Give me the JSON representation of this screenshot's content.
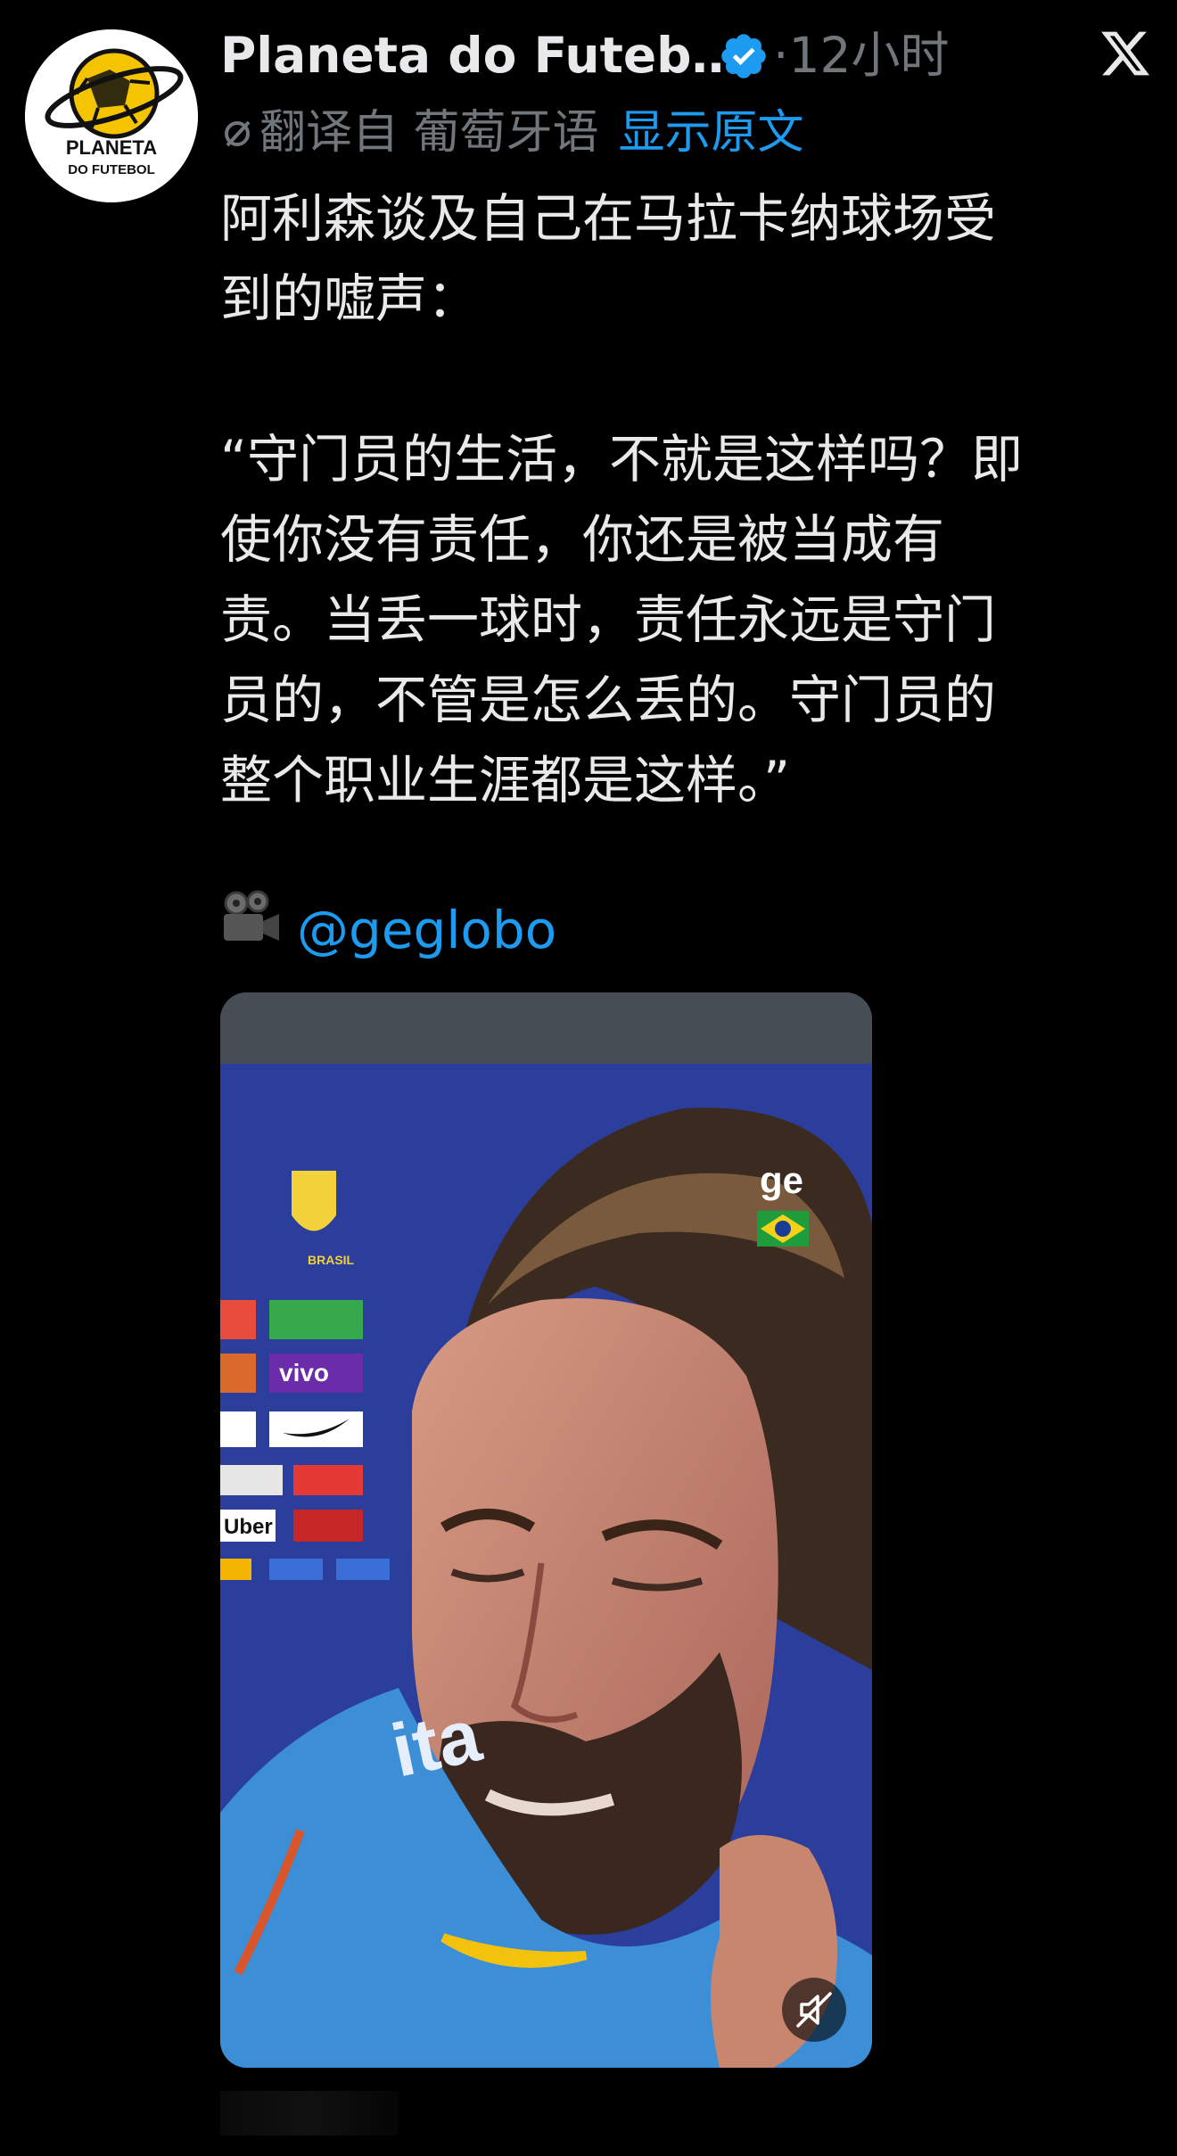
{
  "author": {
    "name": "Planeta do Futeb…",
    "avatar_icon": "planeta-do-futebol-logo",
    "avatar_label_line1": "PLANETA",
    "avatar_label_line2": "DO FUTEBOL",
    "verified_icon": "verified-badge-icon"
  },
  "timestamp": "·12小时",
  "close_icon": "x-logo-icon",
  "translation": {
    "icon": "translate-icon",
    "label": "翻译自 葡萄牙语",
    "show_original": "显示原文"
  },
  "tweet": {
    "line1": "阿利森谈及自己在马拉卡纳球场受",
    "line2": "到的嘘声：",
    "quote1": "“守门员的生活，不就是这样吗？即",
    "quote2": "使你没有责任，你还是被当成有",
    "quote3": "责。当丢一球时，责任永远是守门",
    "quote4": "员的，不管是怎么丢的。守门员的",
    "quote5": "整个职业生涯都是这样。”",
    "credit_icon": "movie-camera-icon",
    "mention": "@geglobo"
  },
  "media": {
    "watermark": "ge",
    "flag_icon": "brazil-flag-icon",
    "backdrop_logo": "BRASIL",
    "sponsor_vivo": "vivo",
    "sponsor_uber": "Uber",
    "shirt_text": "ita",
    "mute_icon": "muted-speaker-icon"
  },
  "colors": {
    "background": "#000000",
    "text": "#e7e9ea",
    "secondary": "#71767b",
    "link": "#1d9bf0",
    "verified": "#1d9bf0"
  }
}
